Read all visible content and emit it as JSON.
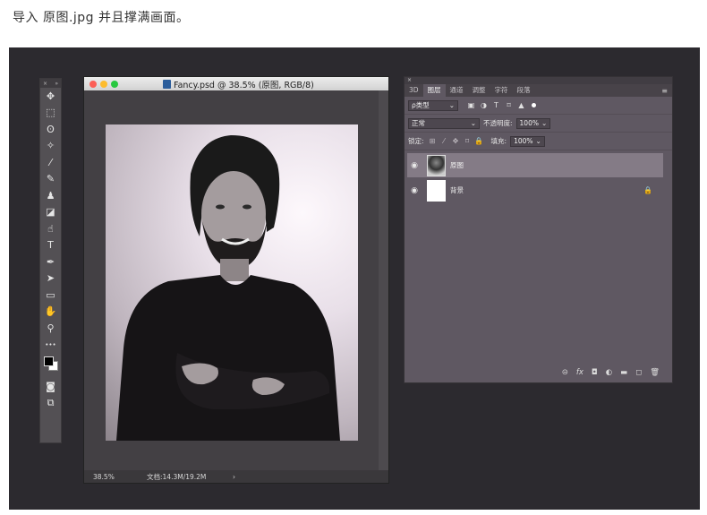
{
  "caption": "导入 原图.jpg 并且撑满画面。",
  "toolbar": {
    "close": "×",
    "collapse": "»",
    "tools": [
      {
        "name": "move-tool",
        "glyph": "✥"
      },
      {
        "name": "marquee-tool",
        "glyph": "⬚"
      },
      {
        "name": "lasso-tool",
        "glyph": "ʘ"
      },
      {
        "name": "magic-wand-tool",
        "glyph": "✧"
      },
      {
        "name": "eyedropper-tool",
        "glyph": "⁄"
      },
      {
        "name": "brush-tool",
        "glyph": "✎"
      },
      {
        "name": "stamp-tool",
        "glyph": "♟"
      },
      {
        "name": "eraser-tool",
        "glyph": "◪"
      },
      {
        "name": "smudge-tool",
        "glyph": "☝"
      },
      {
        "name": "type-tool",
        "glyph": "T"
      },
      {
        "name": "pen-tool",
        "glyph": "✒"
      },
      {
        "name": "path-select-tool",
        "glyph": "➤"
      },
      {
        "name": "rectangle-tool",
        "glyph": "▭"
      },
      {
        "name": "hand-tool",
        "glyph": "✋"
      },
      {
        "name": "zoom-tool",
        "glyph": "⚲"
      },
      {
        "name": "more-tools",
        "glyph": "•••"
      }
    ],
    "bottom_tools": [
      {
        "name": "quick-mask-tool",
        "glyph": "◙"
      },
      {
        "name": "screen-mode-tool",
        "glyph": "⧉"
      }
    ]
  },
  "document": {
    "title": "Fancy.psd @ 38.5% (原图, RGB/8)",
    "zoom": "38.5%",
    "doc_info": "文档:14.3M/19.2M",
    "status_arrow": "›"
  },
  "layers_panel": {
    "tabs": [
      "3D",
      "图层",
      "通道",
      "调整",
      "字符",
      "段落"
    ],
    "active_tab": "图层",
    "filter_kind": "ρ类型",
    "filter_icons": [
      "▣",
      "◑",
      "T",
      "⌑",
      "▲"
    ],
    "blend_mode": "正常",
    "opacity_label": "不透明度:",
    "opacity_value": "100%",
    "lock_label": "锁定:",
    "lock_icons": [
      "⊞",
      "⁄",
      "✥",
      "⌑",
      "🔒"
    ],
    "fill_label": "填充:",
    "fill_value": "100%",
    "layers": [
      {
        "name": "原图",
        "visible": true,
        "selected": true,
        "locked": false
      },
      {
        "name": "背景",
        "visible": true,
        "selected": false,
        "locked": true
      }
    ],
    "footer_icons": [
      "⊝",
      "fx",
      "◘",
      "◐",
      "▬",
      "◻",
      "🗑"
    ]
  },
  "colors": {
    "light_red": "#fc5f56",
    "light_yellow": "#fdbc2e",
    "light_green": "#28c840"
  }
}
